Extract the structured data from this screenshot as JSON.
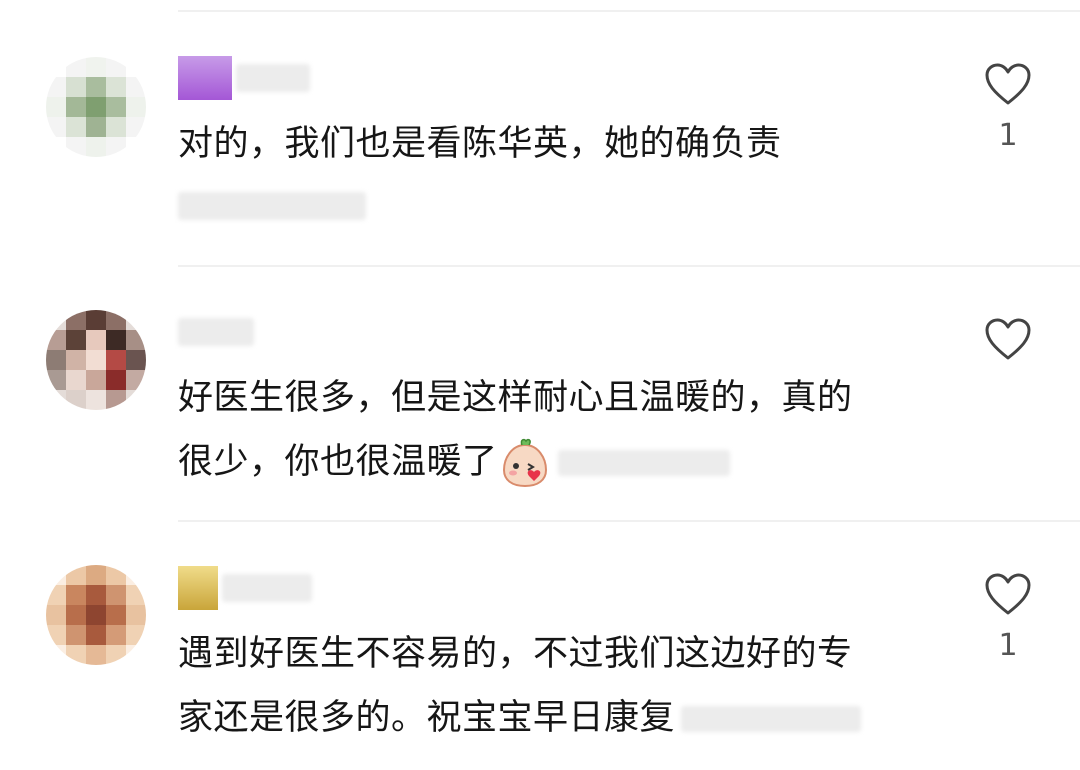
{
  "comments": [
    {
      "text_lines": [
        "对的，我们也是看陈华英，她的确负责"
      ],
      "likes": "1",
      "avatar_colors": [
        "#ffffff",
        "#f4f4f4",
        "#f0f3ee",
        "#f4f4f4",
        "#ffffff",
        "#f4f4f4",
        "#d7e0d2",
        "#a9bd9e",
        "#dbe3d6",
        "#f4f4f4",
        "#eef2ec",
        "#a3b897",
        "#7f9f70",
        "#a9bd9e",
        "#eef2ec",
        "#f4f4f4",
        "#dbe3d6",
        "#9fb393",
        "#dbe3d6",
        "#f4f4f4",
        "#ffffff",
        "#f4f4f4",
        "#eef2ec",
        "#f4f4f4",
        "#ffffff"
      ],
      "tag_color": "#b56be0"
    },
    {
      "text_lines": [
        "好医生很多，但是这样耐心且温暖的，真的",
        "很少，你也很温暖了"
      ],
      "likes": "",
      "avatar_colors": [
        "#e4dcd8",
        "#8c6f66",
        "#5a3d35",
        "#8c6f66",
        "#e4dcd8",
        "#b79d94",
        "#5c4238",
        "#e7c9bd",
        "#3d2a25",
        "#a78f86",
        "#8d7c74",
        "#d0b3a6",
        "#f2ddd3",
        "#b44a45",
        "#6a5450",
        "#a99a93",
        "#e9d7cf",
        "#c9a79a",
        "#8a2c2a",
        "#c3aaa2",
        "#e4dcd8",
        "#dcd0ca",
        "#ede3de",
        "#b79991",
        "#e4dcd8"
      ],
      "emoji_name": "face-blowing-kiss-emoji"
    },
    {
      "text_lines": [
        "遇到好医生不容易的，不过我们这边好的专",
        "家还是很多的。祝宝宝早日康复"
      ],
      "likes": "1",
      "avatar_colors": [
        "#fbeee2",
        "#ecc8a6",
        "#dcaa82",
        "#ecc8a6",
        "#fbeee2",
        "#f0d2b4",
        "#c9865f",
        "#a85a3d",
        "#cf9470",
        "#f0d2b4",
        "#e8c2a0",
        "#b86e4b",
        "#8e4530",
        "#b86e4b",
        "#e8c2a0",
        "#f0d2b4",
        "#cf9470",
        "#a85a3d",
        "#d49b77",
        "#f0d2b4",
        "#fbeee2",
        "#f0d2b4",
        "#e5b996",
        "#f0d2b4",
        "#fbeee2"
      ],
      "tag_color": "#e0c86a"
    }
  ]
}
